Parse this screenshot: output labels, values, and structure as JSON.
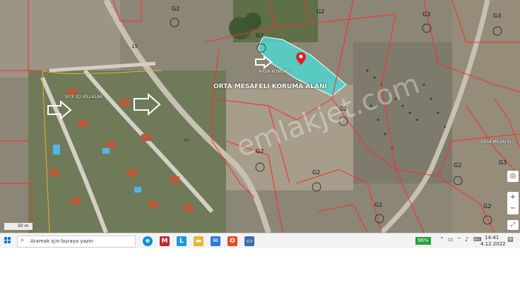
{
  "map": {
    "protection_area_label": "ORTA MESAFELI KORUMA ALANI",
    "parcel_label": "ARSA KONUMU",
    "villa_label": "SİTE İÇİ VİLLALAR",
    "mid_label": "ORTA MESAFELI",
    "watermark": "emlakjet.com",
    "scale_label": "50 m",
    "zones": [
      "G2",
      "G2",
      "G3",
      "G3",
      "G2",
      "G2",
      "G2",
      "G2",
      "G2",
      "G2",
      "G2",
      "G3"
    ],
    "road_labels": [
      "15",
      "45"
    ],
    "colors": {
      "parcel_fill": "#4fd6d0",
      "boundary": "#ff2a2a",
      "road": "#c7c1b4"
    }
  },
  "taskbar": {
    "search_placeholder": "Aramak için buraya yazın",
    "battery": "96%",
    "time": "14:41",
    "date": "4.12.2022"
  }
}
